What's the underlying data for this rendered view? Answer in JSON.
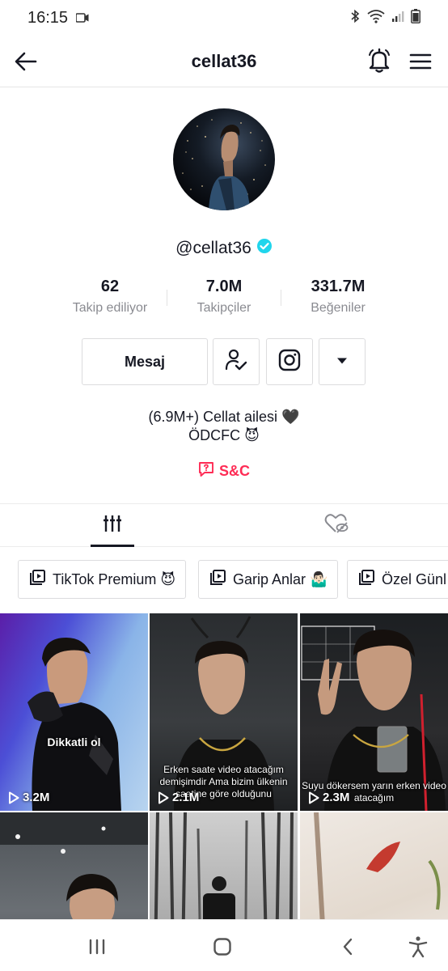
{
  "status_bar": {
    "time": "16:15",
    "icons": [
      "video-record-icon",
      "bluetooth-icon",
      "wifi-icon",
      "signal-icon",
      "battery-icon"
    ]
  },
  "header": {
    "title": "cellat36",
    "icons": [
      "back-arrow-icon",
      "bell-icon",
      "hamburger-menu-icon"
    ]
  },
  "profile": {
    "handle": "@cellat36",
    "verified_icon": "verified-badge-icon",
    "stats": [
      {
        "value": "62",
        "label": "Takip ediliyor"
      },
      {
        "value": "7.0M",
        "label": "Takipçiler"
      },
      {
        "value": "331.7M",
        "label": "Beğeniler"
      }
    ],
    "buttons": {
      "message": "Mesaj",
      "follow_icon": "user-check-icon",
      "instagram_icon": "instagram-icon",
      "more_icon": "caret-down-icon"
    },
    "bio": [
      "(6.9M+) Cellat ailesi 🖤",
      "ÖDCFC 😈"
    ],
    "link": {
      "icon": "message-question-icon",
      "text": "S&C"
    }
  },
  "tabs": [
    {
      "icon": "videos-grid-icon",
      "active": true
    },
    {
      "icon": "liked-hidden-icon",
      "active": false
    }
  ],
  "playlists": [
    {
      "icon": "playlist-icon",
      "label": "TikTok Premium 😈"
    },
    {
      "icon": "playlist-icon",
      "label": "Garip Anlar 🤷🏻‍♂️"
    },
    {
      "icon": "playlist-icon",
      "label": "Özel Günl"
    }
  ],
  "videos": [
    {
      "views": "3.2M",
      "caption": "Dikkatli ol"
    },
    {
      "views": "2.1M",
      "caption": "Erken saate video atacağım demişimdir Ama bizim ülkenin saatine göre olduğunu"
    },
    {
      "views": "2.3M",
      "caption": "Suyu dökersem yarın erken video atacağım"
    },
    {
      "views": "",
      "caption": ""
    },
    {
      "views": "",
      "caption": ""
    },
    {
      "views": "",
      "caption": ""
    }
  ],
  "navbar": {
    "icons": [
      "recent-apps-icon",
      "home-icon",
      "back-icon",
      "accessibility-icon"
    ]
  },
  "colors": {
    "accent": "#fe2c55",
    "verified": "#20d5ec",
    "text": "#161823",
    "muted": "#8a8b91"
  }
}
